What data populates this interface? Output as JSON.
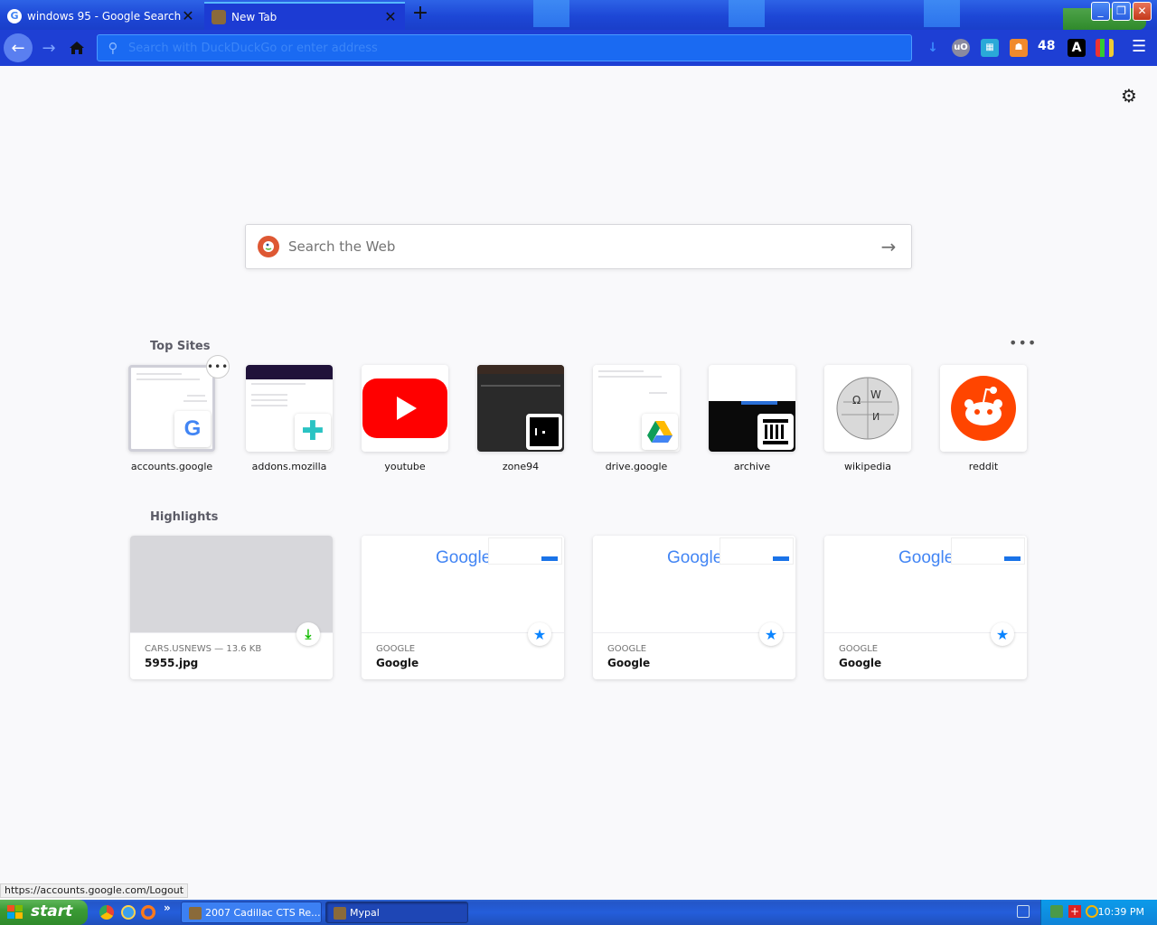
{
  "browser": {
    "tabs": [
      {
        "title": "windows 95 - Google Search",
        "active": false
      },
      {
        "title": "New Tab",
        "active": true
      }
    ],
    "url_placeholder": "Search with DuckDuckGo or enter address",
    "toolbar_badge_count": "48",
    "toolbar_ext_letter": "A",
    "ublock_label": "uO"
  },
  "newtab": {
    "search_placeholder": "Search the Web",
    "top_sites_title": "Top Sites",
    "top_sites": [
      {
        "label": "accounts.google"
      },
      {
        "label": "addons.mozilla"
      },
      {
        "label": "youtube"
      },
      {
        "label": "zone94"
      },
      {
        "label": "drive.google"
      },
      {
        "label": "archive"
      },
      {
        "label": "wikipedia"
      },
      {
        "label": "reddit"
      }
    ],
    "highlights_title": "Highlights",
    "highlights": [
      {
        "source": "CARS.USNEWS — 13.6 KB",
        "title": "5955.jpg",
        "type": "download"
      },
      {
        "source": "GOOGLE",
        "title": "Google",
        "type": "bookmark"
      },
      {
        "source": "GOOGLE",
        "title": "Google",
        "type": "bookmark"
      },
      {
        "source": "GOOGLE",
        "title": "Google",
        "type": "bookmark"
      }
    ],
    "google_logo_text": "Google"
  },
  "status_url": "https://accounts.google.com/Logout",
  "taskbar": {
    "start_label": "start",
    "tasks": [
      {
        "label": "2007 Cadillac CTS Re..."
      },
      {
        "label": "Mypal"
      }
    ],
    "clock": "10:39 PM"
  },
  "colors": {
    "tabstrip": "#1d47d6",
    "navbar": "#1e3fd4",
    "accent_blue": "#0a84ff",
    "reddit": "#ff4500",
    "youtube": "#ff0000",
    "taskbar": "#245edb",
    "start_green": "#3b9b35"
  }
}
